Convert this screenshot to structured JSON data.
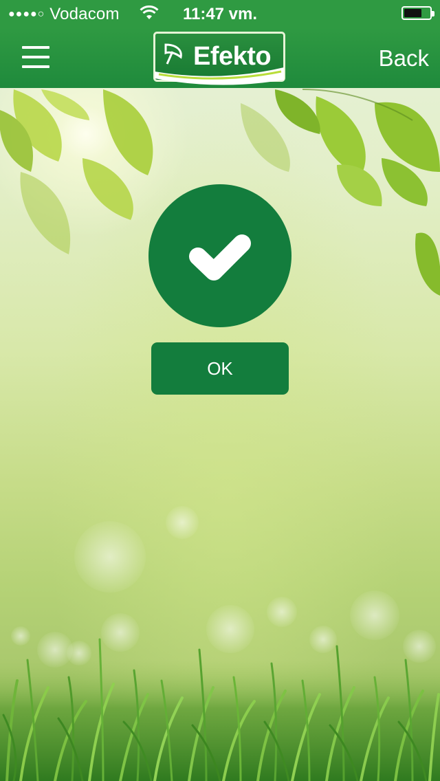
{
  "status_bar": {
    "signal_dots": "●●●●○",
    "carrier": "Vodacom",
    "time": "11:47 vm.",
    "wifi_icon": "wifi-icon",
    "battery_icon": "battery-icon",
    "battery_level": 0.7
  },
  "nav": {
    "menu_icon": "hamburger-menu-icon",
    "logo_text": "Efekto",
    "back_label": "Back"
  },
  "content": {
    "success_icon": "checkmark-icon",
    "ok_label": "OK"
  },
  "colors": {
    "brand_green": "#137d3d",
    "nav_green": "#2f9a42"
  }
}
